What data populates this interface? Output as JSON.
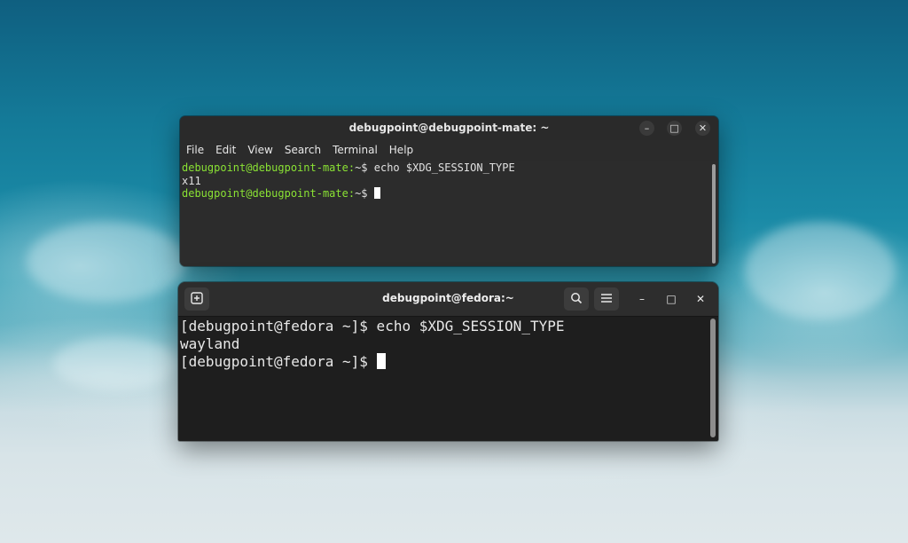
{
  "mate_terminal": {
    "title": "debugpoint@debugpoint-mate: ~",
    "menu": [
      "File",
      "Edit",
      "View",
      "Search",
      "Terminal",
      "Help"
    ],
    "lines": [
      {
        "prompt": "debugpoint@debugpoint-mate:",
        "rest": "~$ echo $XDG_SESSION_TYPE"
      },
      {
        "prompt": "",
        "rest": "x11"
      },
      {
        "prompt": "debugpoint@debugpoint-mate:",
        "rest": "~$ "
      }
    ],
    "prompt_color": "#8ae234"
  },
  "gnome_terminal": {
    "title": "debugpoint@fedora:~",
    "lines": [
      "[debugpoint@fedora ~]$ echo $XDG_SESSION_TYPE",
      "wayland",
      "[debugpoint@fedora ~]$ "
    ]
  },
  "icons": {
    "new_tab": "plus-square-icon",
    "search": "search-icon",
    "menu": "hamburger-icon",
    "minimize": "minimize-icon",
    "maximize": "maximize-icon",
    "close": "close-icon"
  }
}
